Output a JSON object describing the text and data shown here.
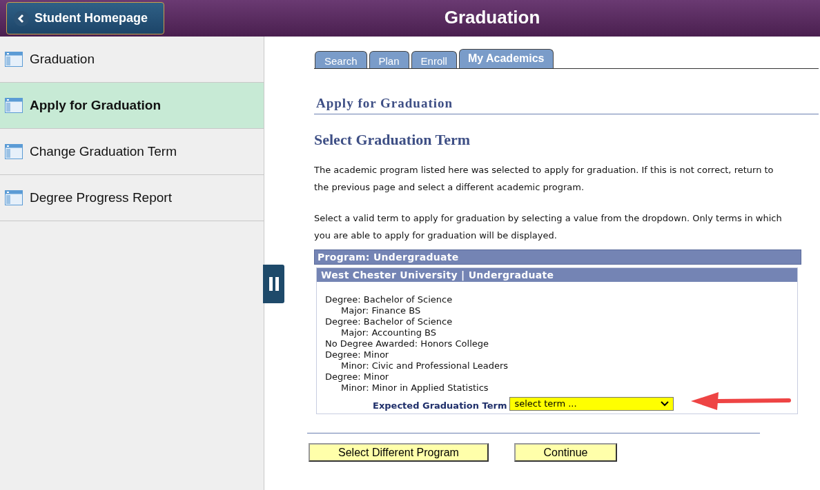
{
  "header": {
    "back_button": "Student Homepage",
    "title": "Graduation"
  },
  "sidebar": {
    "items": [
      {
        "label": "Graduation",
        "selected": false
      },
      {
        "label": "Apply for Graduation",
        "selected": true
      },
      {
        "label": "Change Graduation Term",
        "selected": false
      },
      {
        "label": "Degree Progress Report",
        "selected": false
      }
    ]
  },
  "tabs": [
    {
      "label": "Search",
      "selected": false
    },
    {
      "label": "Plan",
      "selected": false
    },
    {
      "label": "Enroll",
      "selected": false
    },
    {
      "label": "My Academics",
      "selected": true
    }
  ],
  "page_title": "Apply for Graduation",
  "section_title": "Select Graduation Term",
  "paragraphs": [
    "The academic program listed here was selected to apply for graduation. If this is not correct, return to the previous page and select a different academic program.",
    "Select a valid term to apply for graduation by selecting a value from the dropdown. Only terms in which you are able to apply for graduation will be displayed."
  ],
  "program_header": "Program: Undergraduate",
  "institution_header": "West Chester University | Undergraduate",
  "program_lines": [
    {
      "kind": "degree",
      "text": "Degree: Bachelor of Science"
    },
    {
      "kind": "sub",
      "text": "Major: Finance BS"
    },
    {
      "kind": "degree",
      "text": "Degree: Bachelor of Science"
    },
    {
      "kind": "sub",
      "text": "Major: Accounting BS"
    },
    {
      "kind": "degree",
      "text": "No Degree Awarded: Honors College"
    },
    {
      "kind": "degree",
      "text": "Degree: Minor"
    },
    {
      "kind": "sub",
      "text": "Minor: Civic and Professional Leaders"
    },
    {
      "kind": "degree",
      "text": "Degree: Minor"
    },
    {
      "kind": "sub",
      "text": "Minor: Minor in Applied Statistics"
    }
  ],
  "term_field": {
    "label": "Expected Graduation Term",
    "value": "select term ..."
  },
  "buttons": [
    "Select Different Program",
    "Continue"
  ]
}
